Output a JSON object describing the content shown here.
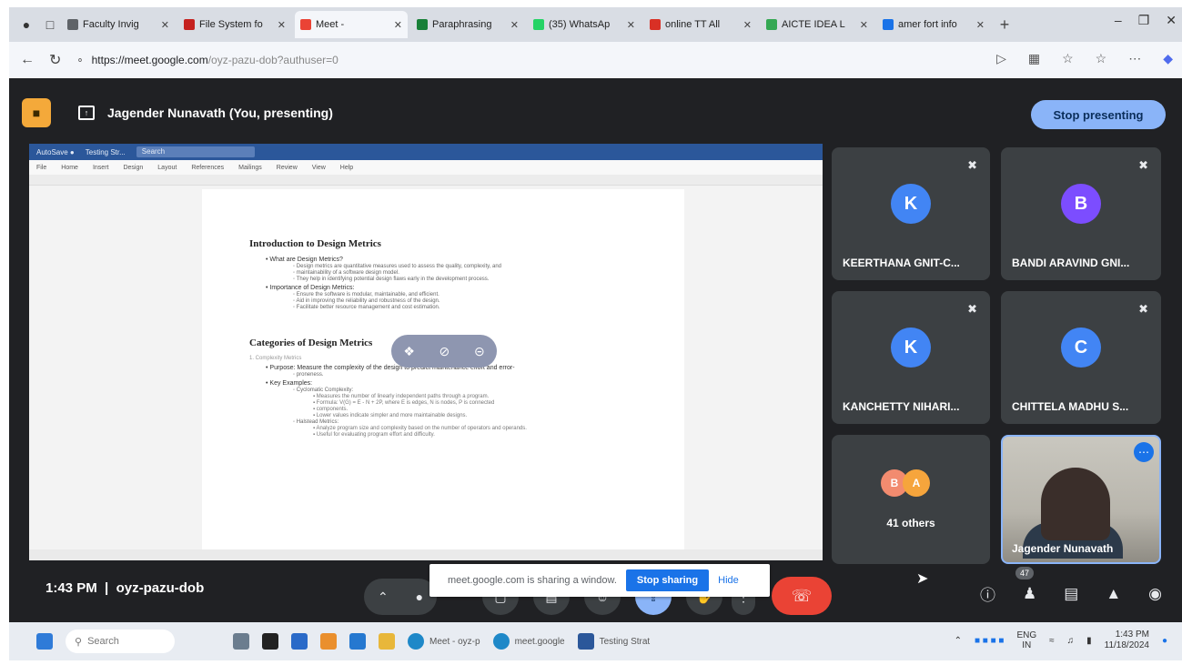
{
  "browser": {
    "tabs": [
      {
        "label": "Faculty Invig",
        "color": "#5f6368",
        "active": false
      },
      {
        "label": "File System fo",
        "color": "#c5221f",
        "active": false
      },
      {
        "label": "Meet -",
        "color": "#ea4335",
        "active": true
      },
      {
        "label": "Paraphrasing",
        "color": "#188038",
        "active": false
      },
      {
        "label": "(35) WhatsAp",
        "color": "#25d366",
        "active": false
      },
      {
        "label": "online TT All",
        "color": "#d93025",
        "active": false
      },
      {
        "label": "AICTE IDEA L",
        "color": "#34a853",
        "active": false
      },
      {
        "label": "amer fort info",
        "color": "#1a73e8",
        "active": false
      }
    ],
    "url_host": "https://meet.google.com",
    "url_path": "/oyz-pazu-dob?authuser=0"
  },
  "meet": {
    "presenter_label": "Jagender Nunavath (You, presenting)",
    "stop_presenting_label": "Stop presenting",
    "meeting_time": "1:43 PM",
    "meeting_code": "oyz-pazu-dob",
    "share_banner_text": "meet.google.com is sharing a window.",
    "stop_sharing_label": "Stop sharing",
    "hide_label": "Hide",
    "people_count": "47",
    "others_label": "41 others",
    "others_initials": [
      "B",
      "A"
    ],
    "participants": [
      {
        "initial": "K",
        "name": "KEERTHANA GNIT-C...",
        "color": "#4285f4"
      },
      {
        "initial": "B",
        "name": "BANDI ARAVIND GNI...",
        "color": "#7c4dff"
      },
      {
        "initial": "K",
        "name": "KANCHETTY NIHARI...",
        "color": "#4285f4"
      },
      {
        "initial": "C",
        "name": "CHITTELA MADHU S...",
        "color": "#4285f4"
      }
    ],
    "self_name": "Jagender Nunavath"
  },
  "document": {
    "ribbon_title": "Testing Str...",
    "search_placeholder": "Search",
    "menu": [
      "File",
      "Home",
      "Insert",
      "Design",
      "Layout",
      "References",
      "Mailings",
      "Review",
      "View",
      "Help"
    ],
    "heading1": "Introduction to Design Metrics",
    "h1_items": [
      {
        "level": 1,
        "text": "What are Design Metrics?"
      },
      {
        "level": 2,
        "text": "Design metrics are quantitative measures used to assess the quality, complexity, and"
      },
      {
        "level": 2,
        "text": "maintainability of a software design model."
      },
      {
        "level": 2,
        "text": "They help in identifying potential design flaws early in the development process."
      },
      {
        "level": 1,
        "text": "Importance of Design Metrics:"
      },
      {
        "level": 2,
        "text": "Ensure the software is modular, maintainable, and efficient."
      },
      {
        "level": 2,
        "text": "Aid in improving the reliability and robustness of the design."
      },
      {
        "level": 2,
        "text": "Facilitate better resource management and cost estimation."
      }
    ],
    "heading2": "Categories of Design Metrics",
    "subheading": "1. Complexity Metrics",
    "h2_items": [
      {
        "level": 1,
        "text": "Purpose: Measure the complexity of the design to predict maintenance effort and error-"
      },
      {
        "level": 2,
        "text": "proneness."
      },
      {
        "level": 1,
        "text": "Key Examples:"
      },
      {
        "level": 2,
        "text": "Cyclomatic Complexity:"
      },
      {
        "level": 3,
        "text": "Measures the number of linearly independent paths through a program."
      },
      {
        "level": 3,
        "text": "Formula: V(G) = E - N + 2P, where E is edges, N is nodes, P is connected"
      },
      {
        "level": 3,
        "text": "components."
      },
      {
        "level": 3,
        "text": "Lower values indicate simpler and more maintainable designs."
      },
      {
        "level": 2,
        "text": "Halstead Metrics:"
      },
      {
        "level": 3,
        "text": "Analyze program size and complexity based on the number of operators and operands."
      },
      {
        "level": 3,
        "text": "Useful for evaluating program effort and difficulty."
      }
    ]
  },
  "taskbar": {
    "search_label": "Search",
    "apps": [
      "Meet - oyz-p",
      "meet.google",
      "Testing Strat"
    ],
    "lang_top": "ENG",
    "lang_bottom": "IN",
    "clock_time": "1:43 PM",
    "clock_date": "11/18/2024"
  }
}
